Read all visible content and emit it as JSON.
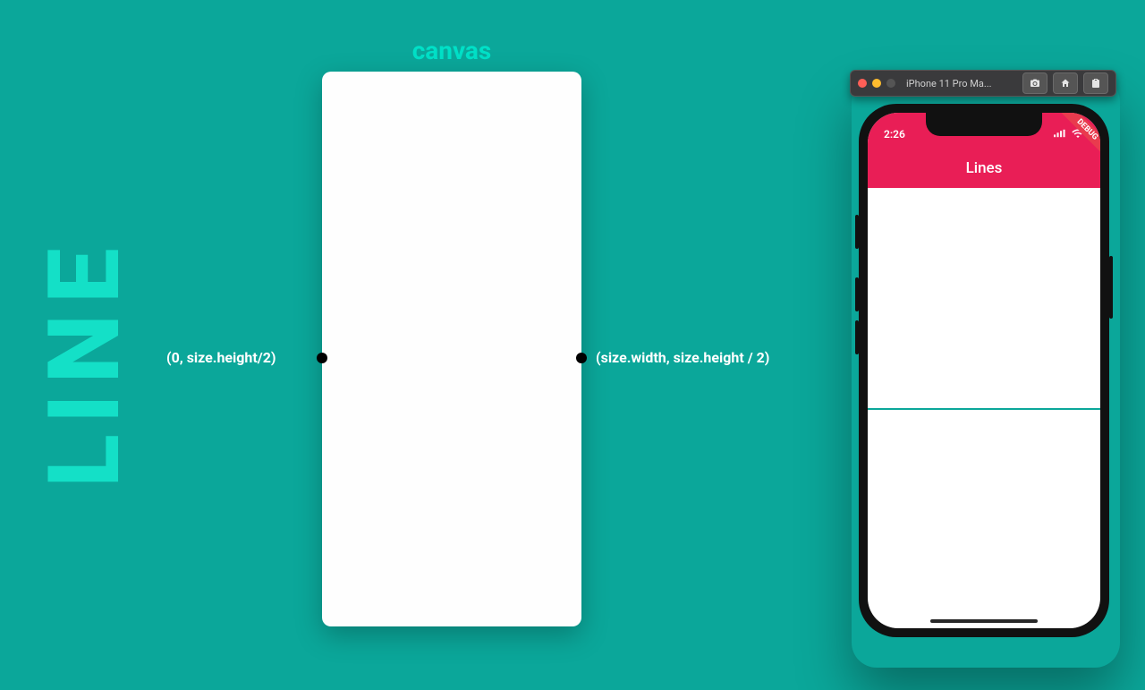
{
  "page": {
    "title_vertical": "LINE",
    "canvas_label": "canvas",
    "left_point_label": "(0, size.height/2)",
    "right_point_label": "(size.width, size.height / 2)"
  },
  "simulator": {
    "toolbar_title": "iPhone 11 Pro Ma...",
    "device_time": "2:26",
    "app_title": "Lines",
    "debug_banner": "DEBUG"
  }
}
